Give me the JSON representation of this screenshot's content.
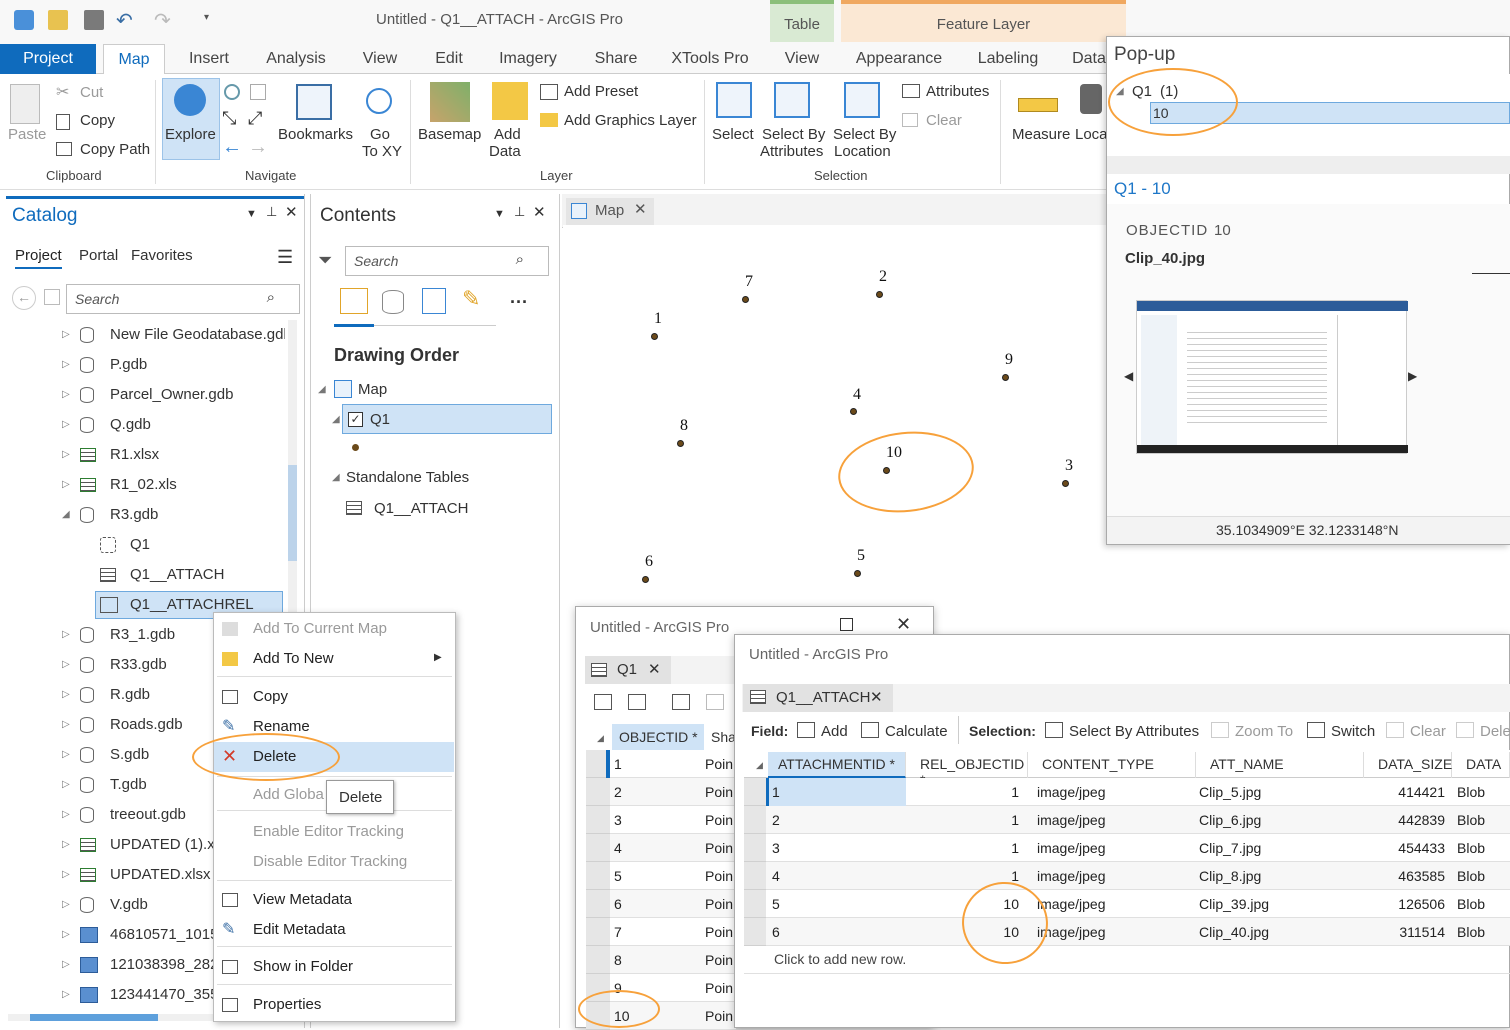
{
  "window": {
    "title": "Untitled - Q1__ATTACH - ArcGIS Pro",
    "context_headers": [
      "Table",
      "Feature Layer"
    ]
  },
  "tabs": [
    "Project",
    "Map",
    "Insert",
    "Analysis",
    "View",
    "Edit",
    "Imagery",
    "Share",
    "XTools Pro",
    "View",
    "Appearance",
    "Labeling",
    "Data"
  ],
  "ribbon": {
    "clipboard": {
      "paste": "Paste",
      "cut": "Cut",
      "copy": "Copy",
      "copy_path": "Copy Path",
      "group": "Clipboard"
    },
    "navigate": {
      "explore": "Explore",
      "bookmarks": "Bookmarks",
      "go_to_xy_1": "Go",
      "go_to_xy_2": "To XY",
      "group": "Navigate"
    },
    "layer": {
      "basemap": "Basemap",
      "add_data_1": "Add",
      "add_data_2": "Data",
      "add_preset": "Add Preset",
      "add_graphics": "Add Graphics Layer",
      "group": "Layer"
    },
    "selection": {
      "select": "Select",
      "sba_1": "Select By",
      "sba_2": "Attributes",
      "sbl_1": "Select By",
      "sbl_2": "Location",
      "attributes": "Attributes",
      "clear": "Clear",
      "group": "Selection"
    },
    "inquiry": {
      "measure": "Measure",
      "locate": "Loca"
    }
  },
  "catalog": {
    "title": "Catalog",
    "tabs": [
      "Project",
      "Portal",
      "Favorites"
    ],
    "search_placeholder": "Search",
    "items": [
      "New File Geodatabase.gdb",
      "P.gdb",
      "Parcel_Owner.gdb",
      "Q.gdb",
      "R1.xlsx",
      "R1_02.xls",
      "R3.gdb",
      "Q1",
      "Q1__ATTACH",
      "Q1__ATTACHREL",
      "R3_1.gdb",
      "R33.gdb",
      "R.gdb",
      "Roads.gdb",
      "S.gdb",
      "T.gdb",
      "treeout.gdb",
      "UPDATED (1).xlsx",
      "UPDATED.xlsx",
      "V.gdb",
      "46810571_1015",
      "121038398_282",
      "123441470_355"
    ]
  },
  "contents": {
    "title": "Contents",
    "search_placeholder": "Search",
    "drawing_order": "Drawing Order",
    "map": "Map",
    "layer": "Q1",
    "standalone": "Standalone Tables",
    "table": "Q1__ATTACH"
  },
  "map_view": {
    "tab": "Map",
    "points": [
      "1",
      "2",
      "3",
      "4",
      "5",
      "6",
      "7",
      "8",
      "9",
      "10"
    ]
  },
  "context_menu": {
    "items": [
      "Add To Current Map",
      "Add To New",
      "Copy",
      "Rename",
      "Delete",
      "Add Globa",
      "Enable Editor Tracking",
      "Disable Editor Tracking",
      "View Metadata",
      "Edit Metadata",
      "Show in Folder",
      "Properties"
    ],
    "tooltip": "Delete"
  },
  "popup": {
    "title": "Pop-up",
    "layer": "Q1",
    "count": "(1)",
    "feature": "10",
    "header": "Q1 - 10",
    "field_name": "OBJECTID",
    "field_value": "10",
    "attachment": "Clip_40.jpg",
    "coords": "35.1034909°E 32.1233148°N"
  },
  "q1_window": {
    "title": "Untitled - ArcGIS Pro",
    "tab": "Q1",
    "col1": "OBJECTID *",
    "col2": "Sha",
    "rows": [
      {
        "id": "1",
        "shape": "Poin"
      },
      {
        "id": "2",
        "shape": "Poin"
      },
      {
        "id": "3",
        "shape": "Poin"
      },
      {
        "id": "4",
        "shape": "Poin"
      },
      {
        "id": "5",
        "shape": "Poin"
      },
      {
        "id": "6",
        "shape": "Poin"
      },
      {
        "id": "7",
        "shape": "Poin"
      },
      {
        "id": "8",
        "shape": "Poin"
      },
      {
        "id": "9",
        "shape": "Poin"
      },
      {
        "id": "10",
        "shape": "Poin"
      }
    ]
  },
  "attach_window": {
    "title": "Untitled - ArcGIS Pro",
    "tab": "Q1__ATTACH",
    "toolbar": {
      "field": "Field:",
      "add": "Add",
      "calculate": "Calculate",
      "selection": "Selection:",
      "sba": "Select By Attributes",
      "zoom_to": "Zoom To",
      "switch": "Switch",
      "clear": "Clear",
      "delete": "Dele"
    },
    "columns": [
      "ATTACHMENTID *",
      "REL_OBJECTID *",
      "CONTENT_TYPE",
      "ATT_NAME",
      "DATA_SIZE",
      "DATA"
    ],
    "rows": [
      {
        "id": "1",
        "rel": "1",
        "type": "image/jpeg",
        "name": "Clip_5.jpg",
        "size": "414421",
        "data": "Blob"
      },
      {
        "id": "2",
        "rel": "1",
        "type": "image/jpeg",
        "name": "Clip_6.jpg",
        "size": "442839",
        "data": "Blob"
      },
      {
        "id": "3",
        "rel": "1",
        "type": "image/jpeg",
        "name": "Clip_7.jpg",
        "size": "454433",
        "data": "Blob"
      },
      {
        "id": "4",
        "rel": "1",
        "type": "image/jpeg",
        "name": "Clip_8.jpg",
        "size": "463585",
        "data": "Blob"
      },
      {
        "id": "5",
        "rel": "10",
        "type": "image/jpeg",
        "name": "Clip_39.jpg",
        "size": "126506",
        "data": "Blob"
      },
      {
        "id": "6",
        "rel": "10",
        "type": "image/jpeg",
        "name": "Clip_40.jpg",
        "size": "311514",
        "data": "Blob"
      }
    ],
    "add_row": "Click to add new row."
  },
  "colors": {
    "accent": "#0f6bbd",
    "annotation": "#f7a13b",
    "selected": "#cfe3f6"
  }
}
